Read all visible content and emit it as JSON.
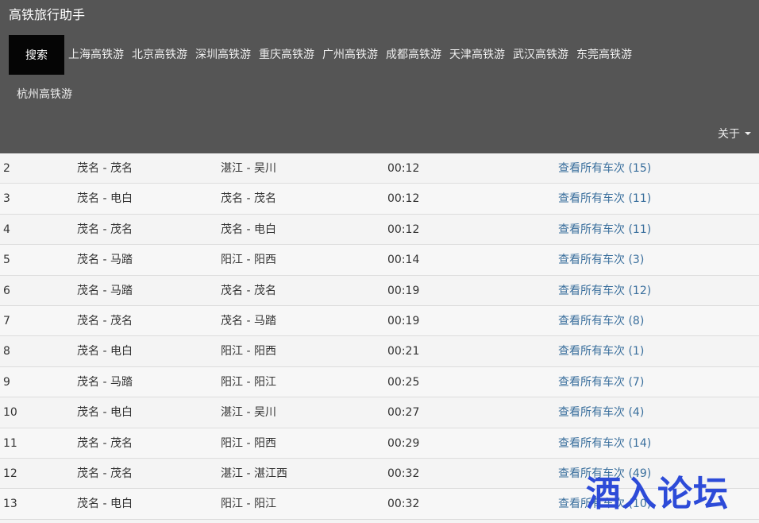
{
  "navbar": {
    "brand": "高铁旅行助手",
    "search_label": "搜索",
    "links": [
      "上海高铁游",
      "北京高铁游",
      "深圳高铁游",
      "重庆高铁游",
      "广州高铁游",
      "成都高铁游",
      "天津高铁游",
      "武汉高铁游",
      "东莞高铁游",
      "杭州高铁游"
    ],
    "about_label": "关于"
  },
  "rows": [
    {
      "no": "2",
      "from": "茂名 - 茂名",
      "to": "湛江 - 吴川",
      "time": "00:12",
      "link": "查看所有车次 (15)"
    },
    {
      "no": "3",
      "from": "茂名 - 电白",
      "to": "茂名 - 茂名",
      "time": "00:12",
      "link": "查看所有车次 (11)"
    },
    {
      "no": "4",
      "from": "茂名 - 茂名",
      "to": "茂名 - 电白",
      "time": "00:12",
      "link": "查看所有车次 (11)"
    },
    {
      "no": "5",
      "from": "茂名 - 马踏",
      "to": "阳江 - 阳西",
      "time": "00:14",
      "link": "查看所有车次 (3)"
    },
    {
      "no": "6",
      "from": "茂名 - 马踏",
      "to": "茂名 - 茂名",
      "time": "00:19",
      "link": "查看所有车次 (12)"
    },
    {
      "no": "7",
      "from": "茂名 - 茂名",
      "to": "茂名 - 马踏",
      "time": "00:19",
      "link": "查看所有车次 (8)"
    },
    {
      "no": "8",
      "from": "茂名 - 电白",
      "to": "阳江 - 阳西",
      "time": "00:21",
      "link": "查看所有车次 (1)"
    },
    {
      "no": "9",
      "from": "茂名 - 马踏",
      "to": "阳江 - 阳江",
      "time": "00:25",
      "link": "查看所有车次 (7)"
    },
    {
      "no": "10",
      "from": "茂名 - 电白",
      "to": "湛江 - 吴川",
      "time": "00:27",
      "link": "查看所有车次 (4)"
    },
    {
      "no": "11",
      "from": "茂名 - 茂名",
      "to": "阳江 - 阳西",
      "time": "00:29",
      "link": "查看所有车次 (14)"
    },
    {
      "no": "12",
      "from": "茂名 - 茂名",
      "to": "湛江 - 湛江西",
      "time": "00:32",
      "link": "查看所有车次 (49)"
    },
    {
      "no": "13",
      "from": "茂名 - 电白",
      "to": "阳江 - 阳江",
      "time": "00:32",
      "link": "查看所有车次 (10)"
    }
  ],
  "watermark": "酒入论坛",
  "colors": {
    "navbar_bg": "#555555",
    "search_bg": "#050505",
    "link": "#3a6f9d",
    "watermark": "#2d4bd8"
  }
}
